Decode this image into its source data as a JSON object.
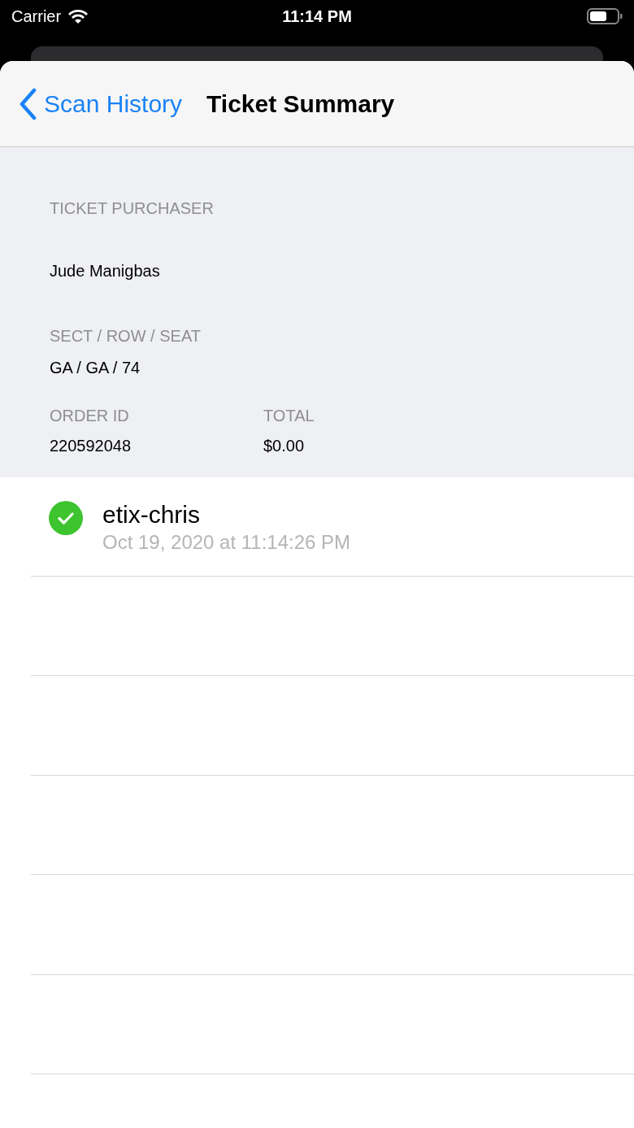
{
  "status_bar": {
    "carrier": "Carrier",
    "time": "11:14 PM"
  },
  "nav": {
    "back_label": "Scan History",
    "title": "Ticket Summary"
  },
  "ticket": {
    "purchaser_label": "TICKET PURCHASER",
    "purchaser": "Jude Manigbas",
    "seat_label": "SECT / ROW / SEAT",
    "seat": "GA / GA / 74",
    "order_label": "ORDER ID",
    "order_id": "220592048",
    "total_label": "TOTAL",
    "total": "$0.00"
  },
  "scans": [
    {
      "kind": "success",
      "user": "etix-chris",
      "time": "Oct 19, 2020 at 11:14:26 PM"
    }
  ]
}
